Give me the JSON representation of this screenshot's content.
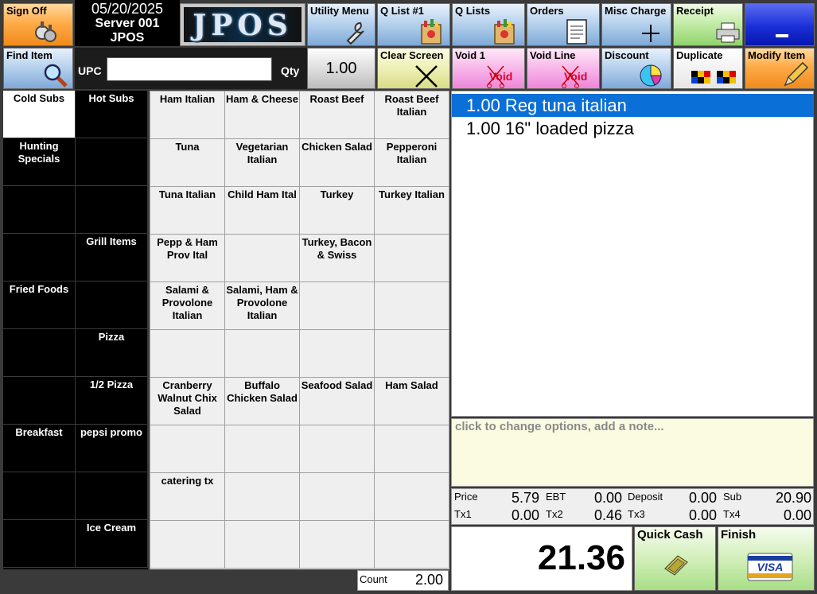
{
  "header": {
    "date": "05/20/2025",
    "server": "Server 001",
    "app": "JPOS",
    "logo_text": "JPOS"
  },
  "toolbar_top": {
    "sign_off": "Sign Off",
    "utility_menu": "Utility Menu",
    "q_list_1": "Q List #1",
    "q_lists": "Q Lists",
    "orders": "Orders",
    "misc_charge": "Misc Charge",
    "receipt": "Receipt"
  },
  "toolbar_second": {
    "find_item": "Find Item",
    "upc_label": "UPC",
    "upc_value": "",
    "qty_label": "Qty",
    "qty_value": "1.00",
    "clear_screen": "Clear Screen",
    "void_1": "Void 1",
    "void_line": "Void Line",
    "discount": "Discount",
    "duplicate": "Duplicate",
    "modify_item": "Modify Item",
    "void_icon_text": "Void"
  },
  "categories": [
    {
      "label": "Cold Subs",
      "selected": true
    },
    {
      "label": "Hot Subs"
    },
    {
      "label": "Hunting Specials"
    },
    {
      "label": ""
    },
    {
      "label": ""
    },
    {
      "label": ""
    },
    {
      "label": ""
    },
    {
      "label": "Grill Items"
    },
    {
      "label": "Fried Foods"
    },
    {
      "label": ""
    },
    {
      "label": ""
    },
    {
      "label": "Pizza"
    },
    {
      "label": ""
    },
    {
      "label": "1/2 Pizza"
    },
    {
      "label": "Breakfast"
    },
    {
      "label": "pepsi promo"
    },
    {
      "label": ""
    },
    {
      "label": ""
    },
    {
      "label": ""
    },
    {
      "label": "Ice Cream"
    }
  ],
  "items": [
    "Ham Italian",
    "Ham & Cheese",
    "Roast Beef",
    "Roast Beef Italian",
    "Tuna",
    "Vegetarian Italian",
    "Chicken Salad",
    "Pepperoni Italian",
    "Tuna Italian",
    "Child Ham Ital",
    "Turkey",
    "Turkey Italian",
    "Pepp & Ham Prov Ital",
    "",
    "Turkey, Bacon & Swiss",
    "",
    "Salami & Provolone Italian",
    "Salami, Ham & Provolone Italian",
    "",
    "",
    "",
    "",
    "",
    "",
    "Cranberry Walnut Chix Salad",
    "Buffalo Chicken Salad",
    "Seafood Salad",
    "Ham Salad",
    "",
    "",
    "",
    "",
    "catering tx",
    "",
    "",
    "",
    "",
    "",
    "",
    ""
  ],
  "order_lines": [
    {
      "text": "1.00 Reg tuna italian",
      "selected": true
    },
    {
      "text": "1.00 16\" loaded pizza",
      "selected": false
    }
  ],
  "note_placeholder": "click to change options, add a note...",
  "totals": {
    "price_label": "Price",
    "price": "5.79",
    "ebt_label": "EBT",
    "ebt": "0.00",
    "deposit_label": "Deposit",
    "deposit": "0.00",
    "sub_label": "Sub",
    "sub": "20.90",
    "tx1_label": "Tx1",
    "tx1": "0.00",
    "tx2_label": "Tx2",
    "tx2": "0.46",
    "tx3_label": "Tx3",
    "tx3": "0.00",
    "tx4_label": "Tx4",
    "tx4": "0.00"
  },
  "grand_total": "21.36",
  "quick_cash": "Quick Cash",
  "finish": "Finish",
  "visa_text": "VISA",
  "count_label": "Count",
  "count_value": "2.00",
  "colors": {
    "selected_line": "#0a6fd6",
    "category_bg": "#000000",
    "item_bg": "#efefef",
    "note_bg": "#fbfbe2"
  }
}
